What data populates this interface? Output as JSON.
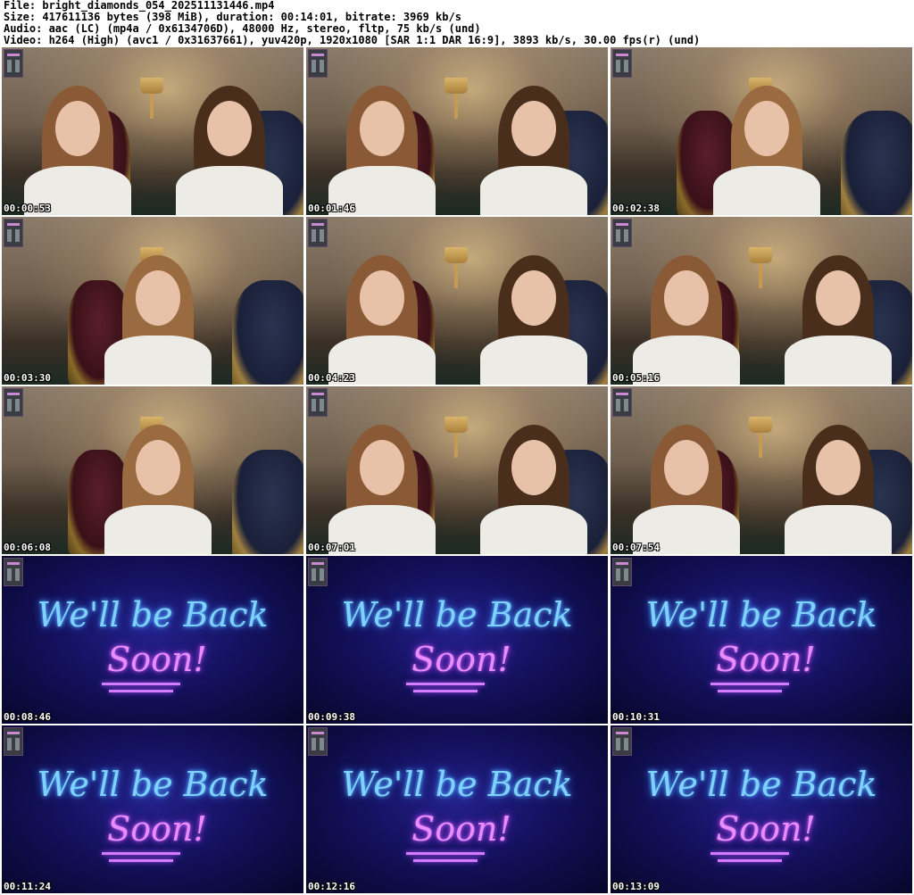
{
  "header": {
    "line1": "File: bright_diamonds_054_202511131446.mp4",
    "line2": "Size: 417611136 bytes (398 MiB), duration: 00:14:01, bitrate: 3969 kb/s",
    "line3": "Audio: aac (LC) (mp4a / 0x6134706D), 48000 Hz, stereo, fltp, 75 kb/s (und)",
    "line4": "Video: h264 (High) (avc1 / 0x31637661), yuv420p, 1920x1080 [SAR 1:1 DAR 16:9], 3893 kb/s, 30.00 fps(r) (und)"
  },
  "brb_text": {
    "line1": "We'll be Back",
    "line2": "Soon!"
  },
  "thumbnails": [
    {
      "timestamp": "00:00:53",
      "scene": "room",
      "people": 2
    },
    {
      "timestamp": "00:01:46",
      "scene": "room",
      "people": 2
    },
    {
      "timestamp": "00:02:38",
      "scene": "room",
      "people": 1
    },
    {
      "timestamp": "00:03:30",
      "scene": "room",
      "people": 1
    },
    {
      "timestamp": "00:04:23",
      "scene": "room",
      "people": 2
    },
    {
      "timestamp": "00:05:16",
      "scene": "room",
      "people": 2
    },
    {
      "timestamp": "00:06:08",
      "scene": "room",
      "people": 1
    },
    {
      "timestamp": "00:07:01",
      "scene": "room",
      "people": 2
    },
    {
      "timestamp": "00:07:54",
      "scene": "room",
      "people": 2
    },
    {
      "timestamp": "00:08:46",
      "scene": "brb",
      "people": 0
    },
    {
      "timestamp": "00:09:38",
      "scene": "brb",
      "people": 0
    },
    {
      "timestamp": "00:10:31",
      "scene": "brb",
      "people": 0
    },
    {
      "timestamp": "00:11:24",
      "scene": "brb",
      "people": 0
    },
    {
      "timestamp": "00:12:16",
      "scene": "brb",
      "people": 0
    },
    {
      "timestamp": "00:13:09",
      "scene": "brb",
      "people": 0
    }
  ],
  "colors": {
    "neon_blue": "#7fd2ff",
    "neon_pink": "#e98cff",
    "brb_background": "#14115e",
    "timestamp_text": "#ffffff"
  }
}
